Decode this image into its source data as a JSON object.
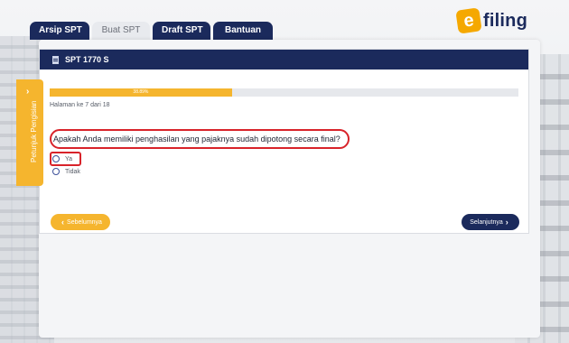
{
  "tabs": [
    {
      "label": "Arsip SPT",
      "active": false
    },
    {
      "label": "Buat SPT",
      "active": true
    },
    {
      "label": "Draft SPT",
      "active": false
    },
    {
      "label": "Bantuan",
      "active": false
    }
  ],
  "logo": {
    "mark": "e",
    "text": "filing"
  },
  "form": {
    "title": "SPT 1770 S",
    "progress": {
      "percent": 38.89,
      "label": "38.89%"
    },
    "page_info": "Halaman ke 7 dari 18",
    "question": "Apakah Anda memiliki penghasilan yang pajaknya sudah dipotong secara final?",
    "options": [
      "Ya",
      "Tidak"
    ],
    "prev_label": "Sebelumnya",
    "next_label": "Selanjutnya"
  },
  "side_panel": {
    "label": "Petunjuk Pengisian"
  },
  "colors": {
    "navy": "#1b2a5c",
    "accent": "#f5b52e",
    "highlight": "#d8232a"
  },
  "icons": {
    "header": "document-icon",
    "prev": "chevron-left-icon",
    "next": "chevron-right-icon",
    "side": "chevron-right-icon"
  }
}
